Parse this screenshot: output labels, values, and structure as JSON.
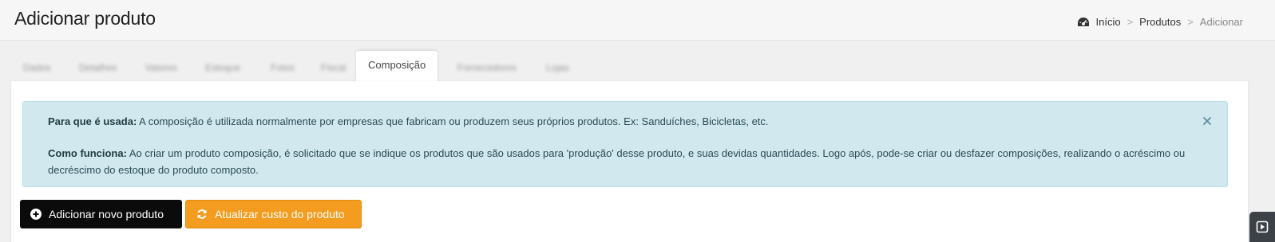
{
  "header": {
    "title": "Adicionar produto",
    "breadcrumb": {
      "home": "Início",
      "separator1": ">",
      "products": "Produtos",
      "separator2": ">",
      "current": "Adicionar"
    }
  },
  "tabs": [
    {
      "label": "Dados",
      "blurred": true
    },
    {
      "label": "Detalhes",
      "blurred": true
    },
    {
      "label": "Valores",
      "blurred": true
    },
    {
      "label": "Estoque",
      "blurred": true
    },
    {
      "label": "Fotos",
      "blurred": true
    },
    {
      "label": "Fiscal",
      "blurred": true
    },
    {
      "label": "Composição",
      "active": true
    },
    {
      "label": "Fornecedores",
      "blurred": true
    },
    {
      "label": "Lojas",
      "blurred": true
    }
  ],
  "alert": {
    "usage_label": "Para que é usada:",
    "usage_text": " A composição é utilizada normalmente por empresas que fabricam ou produzem seus próprios produtos. Ex: Sanduíches, Bicicletas, etc.",
    "how_label": "Como funciona:",
    "how_text": " Ao criar um produto composição, é solicitado que se indique os produtos que são usados para 'produção' desse produto, e suas devidas quantidades. Logo após, pode-se criar ou desfazer composições, realizando o acréscimo ou decréscimo do estoque do produto composto.",
    "close_icon": "close-icon"
  },
  "buttons": {
    "add_product": "Adicionar novo produto",
    "update_cost": "Atualizar custo do produto"
  },
  "colors": {
    "alert_bg": "#d1e9ee",
    "primary_dark": "#0b0b0b",
    "warning": "#f39c1f"
  }
}
